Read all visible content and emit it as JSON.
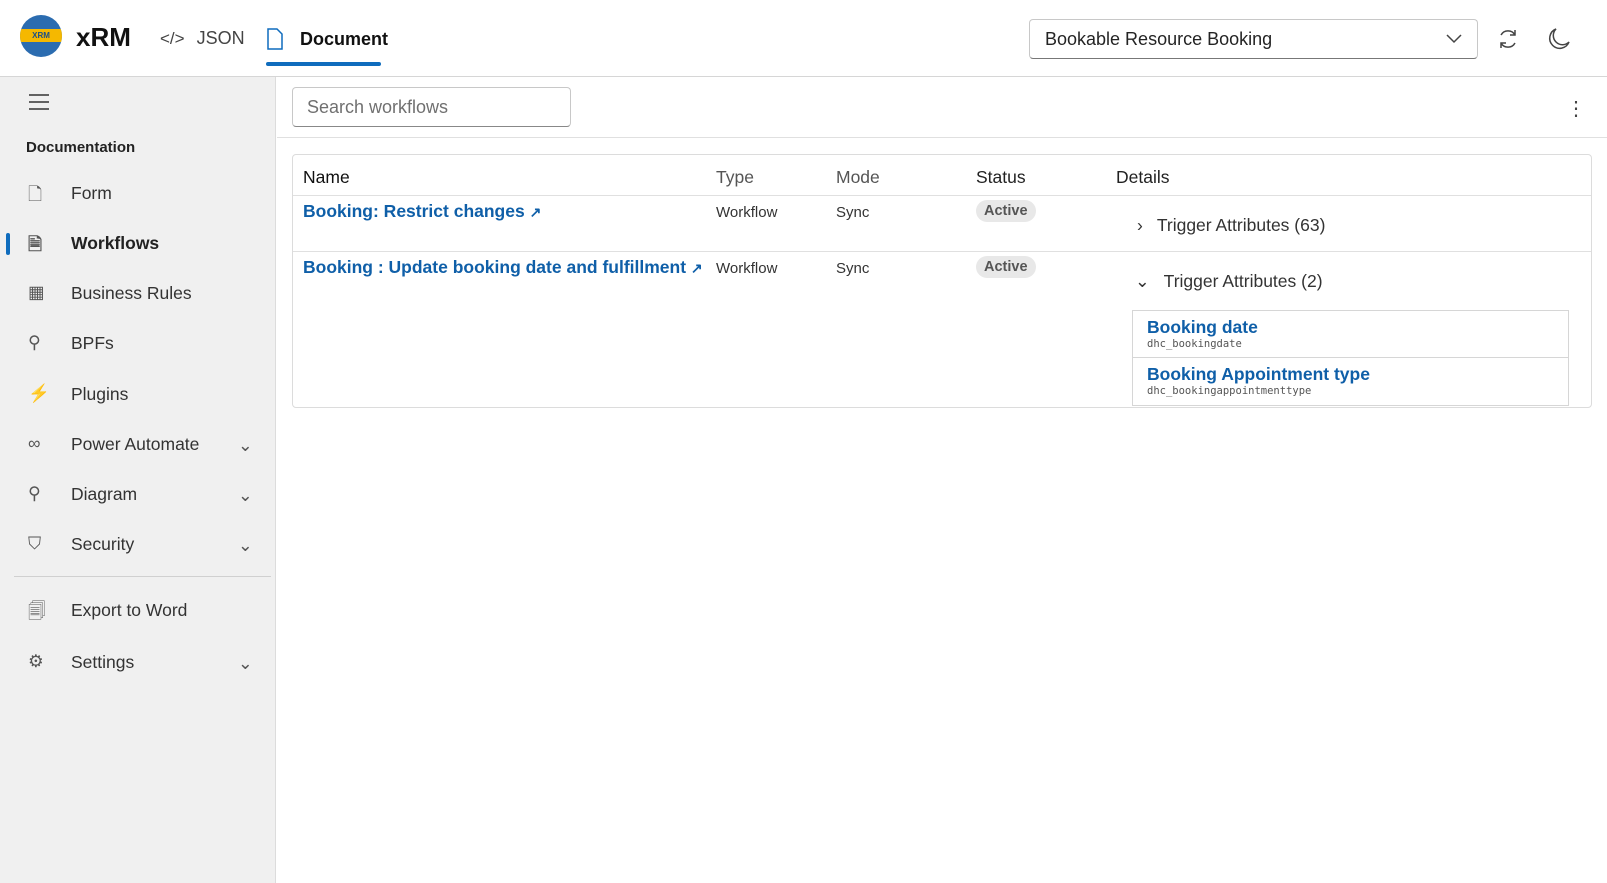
{
  "header": {
    "brand": "xRM",
    "logo_text": "XRM",
    "tabs": [
      {
        "label": "JSON"
      },
      {
        "label": "Document",
        "active": true
      }
    ],
    "entity_select": "Bookable Resource Booking"
  },
  "sidebar": {
    "section": "Documentation",
    "items": [
      {
        "label": "Form"
      },
      {
        "label": "Workflows",
        "active": true
      },
      {
        "label": "Business Rules"
      },
      {
        "label": "BPFs"
      },
      {
        "label": "Plugins"
      },
      {
        "label": "Power Automate"
      },
      {
        "label": "Diagram"
      },
      {
        "label": "Security"
      },
      {
        "label": "Export to Word"
      },
      {
        "label": "Settings"
      }
    ]
  },
  "search": {
    "placeholder": "Search workflows"
  },
  "table": {
    "headers": [
      "Name",
      "Type",
      "Mode",
      "Status",
      "Details"
    ],
    "rows": [
      {
        "name": "Booking: Restrict changes",
        "type": "Workflow",
        "mode": "Sync",
        "status": "Active",
        "details": "Trigger Attributes (63)",
        "expanded": false
      },
      {
        "name": "Booking : Update booking date and fulfillment",
        "type": "Workflow",
        "mode": "Sync",
        "status": "Active",
        "details": "Trigger Attributes (2)",
        "expanded": true,
        "attributes": [
          {
            "label": "Booking date",
            "logical": "dhc_bookingdate"
          },
          {
            "label": "Booking Appointment type",
            "logical": "dhc_bookingappointmenttype"
          }
        ]
      }
    ]
  },
  "colors": {
    "accent": "#0f6cbd",
    "link": "#0f5fa8"
  }
}
